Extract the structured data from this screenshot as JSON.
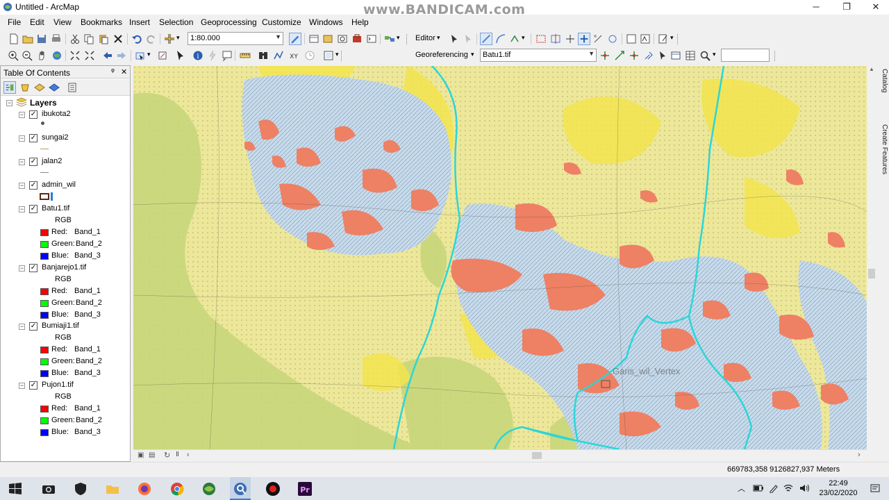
{
  "window": {
    "title": "Untitled - ArcMap",
    "watermark": "www.BANDICAM.com",
    "minimize_glyph": "─",
    "maximize_glyph": "❐",
    "close_glyph": "✕"
  },
  "menu": [
    "File",
    "Edit",
    "View",
    "Bookmarks",
    "Insert",
    "Selection",
    "Geoprocessing",
    "Customize",
    "Windows",
    "Help"
  ],
  "toolbar": {
    "scale": "1:80.000",
    "editor_label": "Editor",
    "georef_label": "Georeferencing",
    "raster_layer": "Batu1.tif",
    "search_value": ""
  },
  "toc": {
    "title": "Table Of Contents",
    "pin_glyph": "ᵠ",
    "close_glyph": "✕",
    "root": "Layers",
    "layers": [
      {
        "name": "ibukota2",
        "legend": [
          "point"
        ]
      },
      {
        "name": "sungai2",
        "legend": [
          "line-tan"
        ]
      },
      {
        "name": "jalan2",
        "legend": [
          "line-gray"
        ]
      },
      {
        "name": "admin_wil",
        "legend": [
          "polygon"
        ]
      },
      {
        "name": "Batu1.tif",
        "rgb": "RGB",
        "bands": [
          {
            "label": "Red:",
            "band": "Band_1",
            "color": "#ff0000"
          },
          {
            "label": "Green:",
            "band": "Band_2",
            "color": "#00ff00"
          },
          {
            "label": "Blue:",
            "band": "Band_3",
            "color": "#0000ff"
          }
        ]
      },
      {
        "name": "Banjarejo1.tif",
        "rgb": "RGB",
        "bands": [
          {
            "label": "Red:",
            "band": "Band_1",
            "color": "#ff0000"
          },
          {
            "label": "Green:",
            "band": "Band_2",
            "color": "#00ff00"
          },
          {
            "label": "Blue:",
            "band": "Band_3",
            "color": "#0000ff"
          }
        ]
      },
      {
        "name": "Bumiaji1.tif",
        "rgb": "RGB",
        "bands": [
          {
            "label": "Red:",
            "band": "Band_1",
            "color": "#ff0000"
          },
          {
            "label": "Green:",
            "band": "Band_2",
            "color": "#00ff00"
          },
          {
            "label": "Blue:",
            "band": "Band_3",
            "color": "#0000ff"
          }
        ]
      },
      {
        "name": "Pujon1.tif",
        "rgb": "RGB",
        "bands": [
          {
            "label": "Red:",
            "band": "Band_1",
            "color": "#ff0000"
          },
          {
            "label": "Green:",
            "band": "Band_2",
            "color": "#00ff00"
          },
          {
            "label": "Blue:",
            "band": "Band_3",
            "color": "#0000ff"
          }
        ]
      }
    ]
  },
  "map": {
    "label_text": "Garis_wil_Vertex",
    "colors": {
      "base": "#ede79a",
      "yellow": "#f2e44d",
      "green": "#c8d67a",
      "blue": "#c7dbea",
      "red": "#ee8064",
      "river": "#2ad6d8"
    }
  },
  "side_tabs": [
    "Catalog",
    "Create Features"
  ],
  "status": {
    "coords": "669783,358  9126827,937 Meters"
  },
  "taskbar": {
    "time": "22:49",
    "date": "23/02/2020"
  }
}
